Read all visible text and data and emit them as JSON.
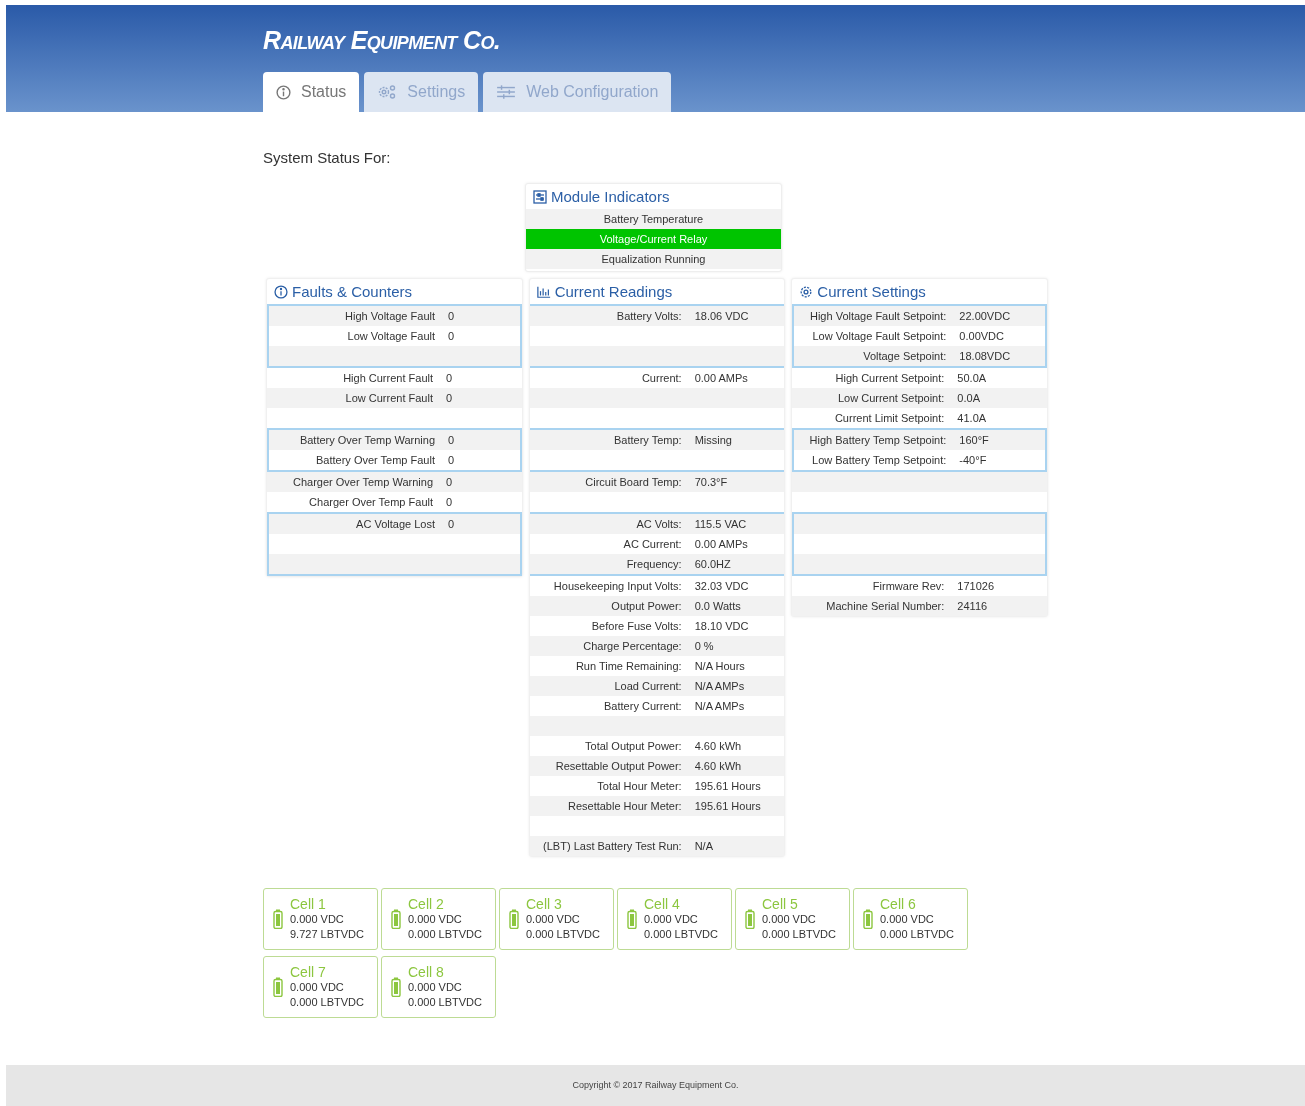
{
  "header": {
    "logo": "Railway Equipment Co."
  },
  "tabs": [
    {
      "label": "Status",
      "kind": "info",
      "selected": true
    },
    {
      "label": "Settings",
      "kind": "gears",
      "selected": false
    },
    {
      "label": "Web Configuration",
      "kind": "sliders",
      "selected": false
    }
  ],
  "page_title": "System Status For:",
  "module_indicators": {
    "title": "Module Indicators",
    "items": [
      {
        "label": "Battery Temperature",
        "on": false
      },
      {
        "label": "Voltage/Current Relay",
        "on": true
      },
      {
        "label": "Equalization Running",
        "on": false
      }
    ]
  },
  "panels": [
    {
      "title": "Faults & Counters",
      "kind": "info",
      "groups": [
        {
          "boxed": true,
          "rows": [
            {
              "kind": "reading",
              "label": "High Voltage Fault",
              "value": "0"
            },
            {
              "kind": "reading",
              "label": "Low Voltage Fault",
              "value": "0"
            },
            {
              "kind": "blank"
            }
          ]
        },
        {
          "boxed": false,
          "rows": [
            {
              "kind": "reading",
              "label": "High Current Fault",
              "value": "0"
            },
            {
              "kind": "reading",
              "label": "Low Current Fault",
              "value": "0"
            },
            {
              "kind": "blank"
            }
          ]
        },
        {
          "boxed": true,
          "rows": [
            {
              "kind": "reading",
              "label": "Battery Over Temp Warning",
              "value": "0"
            },
            {
              "kind": "reading",
              "label": "Battery Over Temp Fault",
              "value": "0"
            }
          ]
        },
        {
          "boxed": false,
          "rows": [
            {
              "kind": "reading",
              "label": "Charger Over Temp Warning",
              "value": "0"
            },
            {
              "kind": "reading",
              "label": "Charger Over Temp Fault",
              "value": "0"
            }
          ]
        },
        {
          "boxed": true,
          "rows": [
            {
              "kind": "reading",
              "label": "AC Voltage Lost",
              "value": "0"
            },
            {
              "kind": "blank"
            },
            {
              "kind": "blank"
            }
          ]
        }
      ]
    },
    {
      "title": "Current Readings",
      "kind": "chart",
      "groups": [
        {
          "boxed": false,
          "rows": [
            {
              "kind": "reading",
              "label": "Battery Volts:",
              "value": "18.06 VDC"
            },
            {
              "kind": "blank"
            },
            {
              "kind": "blank"
            }
          ]
        },
        {
          "boxed": false,
          "rows": [
            {
              "kind": "reading",
              "label": "Current:",
              "value": "0.00 AMPs"
            },
            {
              "kind": "blank"
            },
            {
              "kind": "blank"
            }
          ]
        },
        {
          "boxed": false,
          "rows": [
            {
              "kind": "reading",
              "label": "Battery Temp:",
              "value": "Missing"
            },
            {
              "kind": "blank"
            }
          ]
        },
        {
          "boxed": false,
          "rows": [
            {
              "kind": "reading",
              "label": "Circuit Board Temp:",
              "value": "70.3°F"
            },
            {
              "kind": "blank"
            }
          ]
        },
        {
          "boxed": false,
          "rows": [
            {
              "kind": "reading",
              "label": "AC Volts:",
              "value": "115.5 VAC"
            },
            {
              "kind": "reading",
              "label": "AC Current:",
              "value": "0.00 AMPs"
            },
            {
              "kind": "reading",
              "label": "Frequency:",
              "value": "60.0HZ"
            }
          ]
        },
        {
          "boxed": false,
          "rows": [
            {
              "kind": "reading",
              "label": "Housekeeping Input Volts:",
              "value": "32.03 VDC"
            },
            {
              "kind": "reading",
              "label": "Output Power:",
              "value": "0.0 Watts"
            },
            {
              "kind": "reading",
              "label": "Before Fuse Volts:",
              "value": "18.10 VDC"
            },
            {
              "kind": "reading",
              "label": "Charge Percentage:",
              "value": "0 %"
            },
            {
              "kind": "reading",
              "label": "Run Time Remaining:",
              "value": "N/A Hours"
            },
            {
              "kind": "reading",
              "label": "Load Current:",
              "value": "N/A AMPs"
            },
            {
              "kind": "reading",
              "label": "Battery Current:",
              "value": "N/A AMPs"
            },
            {
              "kind": "blank"
            },
            {
              "kind": "reading",
              "label": "Total Output Power:",
              "value": "4.60 kWh"
            },
            {
              "kind": "reading",
              "label": "Resettable Output Power:",
              "value": "4.60 kWh"
            },
            {
              "kind": "reading",
              "label": "Total Hour Meter:",
              "value": "195.61 Hours"
            },
            {
              "kind": "reading",
              "label": "Resettable Hour Meter:",
              "value": "195.61 Hours"
            },
            {
              "kind": "blank"
            },
            {
              "kind": "reading",
              "label": "(LBT) Last Battery Test Run:",
              "value": "N/A"
            }
          ]
        }
      ]
    },
    {
      "title": "Current Settings",
      "kind": "gear",
      "groups": [
        {
          "boxed": true,
          "rows": [
            {
              "kind": "reading",
              "label": "High Voltage Fault Setpoint:",
              "value": "22.00VDC"
            },
            {
              "kind": "reading",
              "label": "Low Voltage Fault Setpoint:",
              "value": "0.00VDC"
            },
            {
              "kind": "reading",
              "label": "Voltage Setpoint:",
              "value": "18.08VDC"
            }
          ]
        },
        {
          "boxed": false,
          "rows": [
            {
              "kind": "reading",
              "label": "High Current Setpoint:",
              "value": "50.0A"
            },
            {
              "kind": "reading",
              "label": "Low Current Setpoint:",
              "value": "0.0A"
            },
            {
              "kind": "reading",
              "label": "Current Limit Setpoint:",
              "value": "41.0A"
            }
          ]
        },
        {
          "boxed": true,
          "rows": [
            {
              "kind": "reading",
              "label": "High Battery Temp Setpoint:",
              "value": "160°F"
            },
            {
              "kind": "reading",
              "label": "Low Battery Temp Setpoint:",
              "value": "-40°F"
            }
          ]
        },
        {
          "boxed": false,
          "rows": [
            {
              "kind": "blank"
            },
            {
              "kind": "blank"
            }
          ]
        },
        {
          "boxed": true,
          "rows": [
            {
              "kind": "blank"
            },
            {
              "kind": "blank"
            },
            {
              "kind": "blank"
            }
          ]
        },
        {
          "boxed": false,
          "rows": [
            {
              "kind": "reading",
              "label": "Firmware Rev:",
              "value": "171026"
            },
            {
              "kind": "reading",
              "label": "Machine Serial Number:",
              "value": "24116"
            }
          ]
        }
      ]
    }
  ],
  "cells": [
    {
      "title": "Cell 1",
      "lines": [
        "0.000 VDC",
        "9.727 LBTVDC"
      ]
    },
    {
      "title": "Cell 2",
      "lines": [
        "0.000 VDC",
        "0.000 LBTVDC"
      ]
    },
    {
      "title": "Cell 3",
      "lines": [
        "0.000 VDC",
        "0.000 LBTVDC"
      ]
    },
    {
      "title": "Cell 4",
      "lines": [
        "0.000 VDC",
        "0.000 LBTVDC"
      ]
    },
    {
      "title": "Cell 5",
      "lines": [
        "0.000 VDC",
        "0.000 LBTVDC"
      ]
    },
    {
      "title": "Cell 6",
      "lines": [
        "0.000 VDC",
        "0.000 LBTVDC"
      ]
    },
    {
      "title": "Cell 7",
      "lines": [
        "0.000 VDC",
        "0.000 LBTVDC"
      ]
    },
    {
      "title": "Cell 8",
      "lines": [
        "0.000 VDC",
        "0.000 LBTVDC"
      ]
    }
  ],
  "footer": "Copyright © 2017 Railway Equipment Co."
}
